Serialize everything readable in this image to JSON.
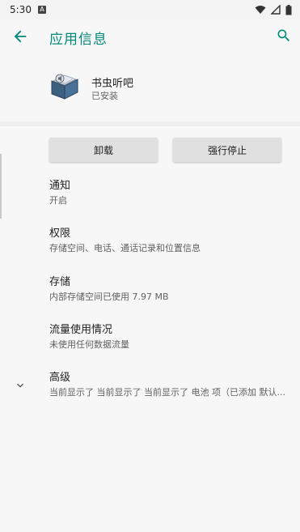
{
  "status_bar": {
    "time": "5:30",
    "notification_icon": "A",
    "icons": [
      "wifi-icon",
      "signal-icon",
      "battery-icon"
    ]
  },
  "app_bar": {
    "back_icon": "arrow-back-icon",
    "title": "应用信息",
    "search_icon": "search-icon"
  },
  "app": {
    "name": "书虫听吧",
    "status": "已安装"
  },
  "buttons": {
    "uninstall": "卸载",
    "force_stop": "强行停止"
  },
  "settings": [
    {
      "title": "通知",
      "summary": "开启"
    },
    {
      "title": "权限",
      "summary": "存储空间、电话、通话记录和位置信息"
    },
    {
      "title": "存储",
      "summary": "内部存储空间已使用 7.97 MB"
    },
    {
      "title": "流量使用情况",
      "summary": "未使用任何数据流量"
    },
    {
      "title": "高级",
      "summary": "当前显示了 当前显示了 当前显示了 电池 项（已添加 默认..."
    }
  ],
  "colors": {
    "accent": "#00897b",
    "background": "#f7f7f7",
    "button": "#e0e0e0"
  }
}
